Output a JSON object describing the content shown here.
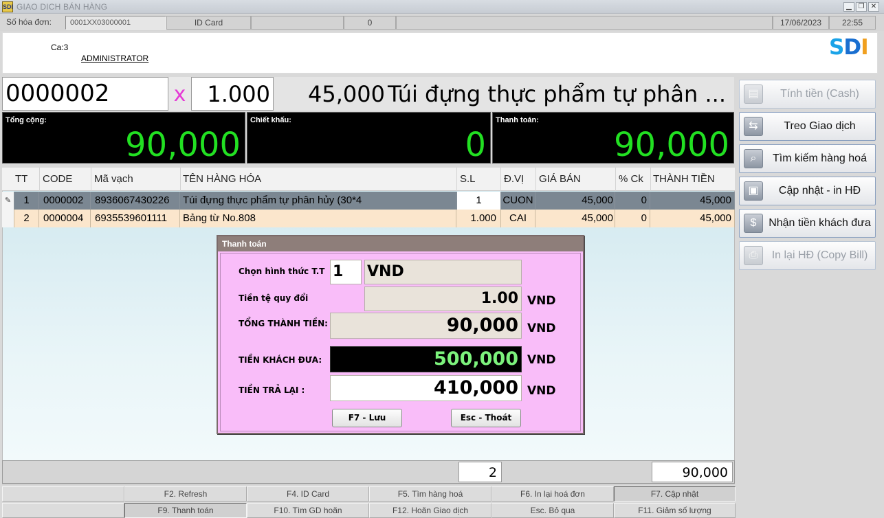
{
  "window": {
    "app_icon": "SDI",
    "title": "GIAO DICH BÁN HÀNG",
    "min_icon": "minimize-icon",
    "max_icon": "restore-icon",
    "close_icon": "close-icon"
  },
  "info": {
    "invoice_label": "Số hóa đơn:",
    "invoice_no": "0001XX03000001",
    "idcard_label": "ID Card",
    "idcard_value": "",
    "count": "0",
    "date": "17/06/2023",
    "time": "22:55"
  },
  "header": {
    "shift": "Ca:3",
    "user": "ADMINISTRATOR",
    "logo": {
      "s": "S",
      "d": "D",
      "i": "I"
    },
    "logo_colors": {
      "s": "#1aa3e8",
      "d": "#1a6fd0",
      "i": "#f0a020"
    }
  },
  "entry": {
    "code": "0000002",
    "multiplier": "x",
    "quantity": "1.000",
    "price": "45,000",
    "item_name": "Túi đựng thực phẩm tự phân ..."
  },
  "totals": {
    "total_label": "Tổng cộng:",
    "total_value": "90,000",
    "discount_label": "Chiết khấu:",
    "discount_value": "0",
    "payment_label": "Thanh toán:",
    "payment_value": "90,000",
    "value_color": "#22e022"
  },
  "grid": {
    "headers": [
      "TT",
      "CODE",
      "Mã vạch",
      "TÊN HÀNG HÓA",
      "S.L",
      "Đ.VỊ",
      "GIÁ BÁN",
      "% Ck",
      "THÀNH TIỀN"
    ],
    "rows": [
      {
        "tt": "1",
        "code": "0000002",
        "barcode": "8936067430226",
        "name": "Túi đựng thực phẩm tự phân hủy (30*4",
        "qty": "1",
        "unit": "CUON",
        "price": "45,000",
        "ck": "0",
        "amount": "45,000",
        "marker": "✎"
      },
      {
        "tt": "2",
        "code": "0000004",
        "barcode": "6935539601111",
        "name": "Bảng từ No.808",
        "qty": "1.000",
        "unit": "CAI",
        "price": "45,000",
        "ck": "0",
        "amount": "45,000",
        "marker": ""
      }
    ],
    "footer_count": "2",
    "footer_total": "90,000"
  },
  "dialog": {
    "title": "Thanh toán",
    "method_label": "Chọn hình thức T.T",
    "method_code": "1",
    "method_currency": "VND",
    "rate_label": "Tiền tệ quy đổi",
    "rate_value": "1.00",
    "total_label": "TỔNG THÀNH TIỀN:",
    "total_value": "90,000",
    "given_label": "TIỀN KHÁCH ĐƯA:",
    "given_value": "500,000",
    "change_label": "TIỀN TRẢ LẠI :",
    "change_value": "410,000",
    "unit": "VND",
    "save_button": "F7 - Lưu",
    "exit_button": "Esc - Thoát",
    "given_color": "#7cf27c"
  },
  "fkeys": {
    "row1": [
      "F2. Refresh",
      "F4. ID Card",
      "F5. Tìm hàng hoá",
      "F6. In lại hoá đơn",
      "F7. Cập nhật"
    ],
    "row2": [
      "F9. Thanh toán",
      "F10. Tìm GD hoãn",
      "F12. Hoãn Giao dịch",
      "Esc. Bỏ qua",
      "F11. Giảm số lượng"
    ]
  },
  "actions": [
    {
      "label": "Tính tiền (Cash)",
      "icon": "cash-icon",
      "glyph": "▤",
      "enabled": false
    },
    {
      "label": "Treo Giao dịch",
      "icon": "hold-transaction-icon",
      "glyph": "⇆",
      "enabled": true
    },
    {
      "label": "Tìm kiếm hàng hoá",
      "icon": "magnifier-icon",
      "glyph": "⌕",
      "enabled": true
    },
    {
      "label": "Cập nhật - in HĐ",
      "icon": "save-disk-icon",
      "glyph": "▣",
      "enabled": true
    },
    {
      "label": "Nhận tiền khách đưa",
      "icon": "money-hand-icon",
      "glyph": "$",
      "enabled": true
    },
    {
      "label": "In lại HĐ (Copy Bill)",
      "icon": "printer-icon",
      "glyph": "⎙",
      "enabled": false
    }
  ]
}
